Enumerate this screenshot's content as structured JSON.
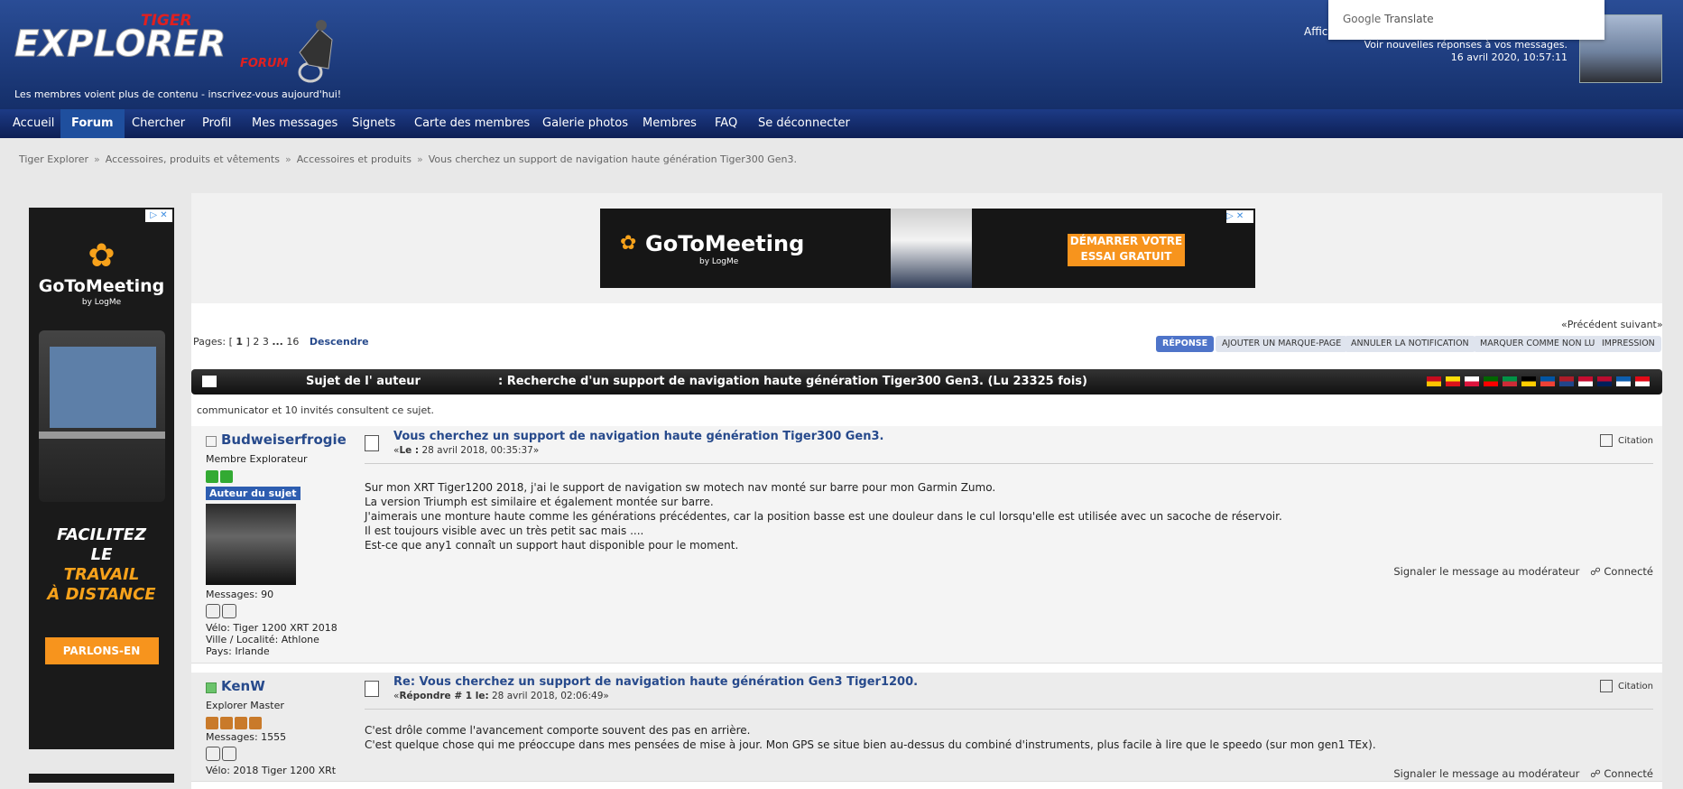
{
  "header": {
    "logo_top": "TIGER",
    "logo_main": "EXPLORER",
    "logo_sub": "FORUM",
    "tagline": "Les membres voient plus de contenu - inscrivez-vous aujourd'hui!",
    "affi_text": "Affich",
    "new_replies": "Voir nouvelles réponses à vos messages.",
    "datetime": "16 avril 2020, 10:57:11"
  },
  "google_translate": {
    "brand": "Google",
    "label": "Translate"
  },
  "nav": {
    "items": [
      {
        "label": "Accueil",
        "active": false
      },
      {
        "label": "Forum",
        "active": true
      },
      {
        "label": "Chercher",
        "active": false
      },
      {
        "label": "Profil",
        "active": false
      },
      {
        "label": "Mes messages",
        "active": false
      },
      {
        "label": "Signets",
        "active": false
      },
      {
        "label": "Carte des membres",
        "active": false
      },
      {
        "label": "Galerie photos",
        "active": false
      },
      {
        "label": "Membres",
        "active": false
      },
      {
        "label": "FAQ",
        "active": false
      },
      {
        "label": "Se déconnecter",
        "active": false
      }
    ]
  },
  "breadcrumb": [
    "Tiger Explorer",
    "Accessoires, produits et vêtements",
    "Accessoires et produits",
    "Vous cherchez un support de navigation haute génération Tiger300 Gen3."
  ],
  "ads": {
    "left": {
      "brand": "GoToMeeting",
      "by": "by LogMe",
      "headline_1": "FACILITEZ",
      "headline_2": "LE",
      "headline_3": "TRAVAIL",
      "headline_4": "À DISTANCE",
      "cta": "PARLONS-EN"
    },
    "top": {
      "brand": "GoToMeeting",
      "by": "by LogMe",
      "cta_1": "DÉMARRER VOTRE",
      "cta_2": "ESSAI GRATUIT"
    }
  },
  "pagination": {
    "label": "Pages:",
    "current": "1",
    "p2": "2",
    "p3": "3",
    "ellipsis": "...",
    "last": "16",
    "down": "Descendre",
    "prevnext": "«Précédent suivant»"
  },
  "actions": {
    "reply": "RÉPONSE",
    "bookmark": "AJOUTER UN MARQUE-PAGE",
    "unnotify": "ANNULER LA NOTIFICATION",
    "mark_unread": "MARQUER COMME NON LU",
    "print": "IMPRESSION"
  },
  "topic": {
    "author_col": "Sujet de l' auteur",
    "title": ": Recherche d'un support de navigation haute génération Tiger300 Gen3. (Lu 23325 fois)"
  },
  "flags": [
    {
      "name": "spanish-flag",
      "colors": [
        "#c60b1e",
        "#ffc400"
      ]
    },
    {
      "name": "catalan-flag",
      "colors": [
        "#fcdd09",
        "#da121a"
      ]
    },
    {
      "name": "polish-flag",
      "colors": [
        "#ffffff",
        "#dc143c"
      ]
    },
    {
      "name": "portuguese-flag",
      "colors": [
        "#006600",
        "#ff0000"
      ]
    },
    {
      "name": "italian-flag",
      "colors": [
        "#009246",
        "#ce2b37"
      ]
    },
    {
      "name": "german-flag",
      "colors": [
        "#000000",
        "#ffce00"
      ]
    },
    {
      "name": "french-flag",
      "colors": [
        "#0055a4",
        "#ef4135"
      ]
    },
    {
      "name": "dutch-flag",
      "colors": [
        "#ae1c28",
        "#21468b"
      ]
    },
    {
      "name": "danish-flag",
      "colors": [
        "#c60c30",
        "#ffffff"
      ]
    },
    {
      "name": "norwegian-flag",
      "colors": [
        "#ba0c2f",
        "#00205b"
      ]
    },
    {
      "name": "greek-flag",
      "colors": [
        "#0d5eaf",
        "#ffffff"
      ]
    },
    {
      "name": "turkish-flag",
      "colors": [
        "#e30a17",
        "#ffffff"
      ]
    }
  ],
  "viewers": {
    "user": "communicator",
    "rest": "et 10 invités consultent ce sujet."
  },
  "posts": [
    {
      "author": "Budweiserfrogie",
      "online": false,
      "rank": "Membre Explorateur",
      "badge": "Auteur du sujet",
      "messages": "Messages: 90",
      "velo": "Vélo: Tiger 1200 XRT 2018",
      "ville": "Ville / Localité: Athlone",
      "pays": "Pays: Irlande",
      "subject": "Vous cherchez un support de navigation haute génération Tiger300 Gen3.",
      "date_prefix": "«",
      "date_bold": "Le :",
      "date": "28 avril 2018, 00:35:37»",
      "quote": "Citation",
      "lines": [
        "Sur mon XRT Tiger1200 2018, j'ai le support de navigation sw motech nav monté sur barre pour mon Garmin Zumo.",
        "La version Triumph est similaire et également montée sur barre.",
        "J'aimerais une monture haute comme les générations précédentes, car la position basse est une douleur dans le cul lorsqu'elle est utilisée avec un sacoche de réservoir.",
        "Il est toujours visible avec un très petit sac mais ....",
        "Est-ce que any1 connaît un support haut disponible pour le moment."
      ],
      "report": "Signaler le message au modérateur",
      "connected": "Connecté"
    },
    {
      "author": "KenW",
      "online": true,
      "rank": "Explorer Master",
      "messages": "Messages: 1555",
      "velo": "Vélo: 2018 Tiger 1200 XRt",
      "subject": "Re: Vous cherchez un support de navigation haute génération Gen3 Tiger1200.",
      "date_prefix": "«",
      "date_bold": "Répondre # 1 le:",
      "date": "28 avril 2018, 02:06:49»",
      "quote": "Citation",
      "lines": [
        "C'est drôle comme l'avancement comporte souvent des pas en arrière.",
        "C'est quelque chose qui me préoccupe dans mes pensées de mise à jour. Mon GPS se situe bien au-dessus du combiné d'instruments, plus facile à lire que le speedo (sur mon gen1 TEx)."
      ],
      "report": "Signaler le message au modérateur",
      "connected": "Connecté"
    }
  ]
}
